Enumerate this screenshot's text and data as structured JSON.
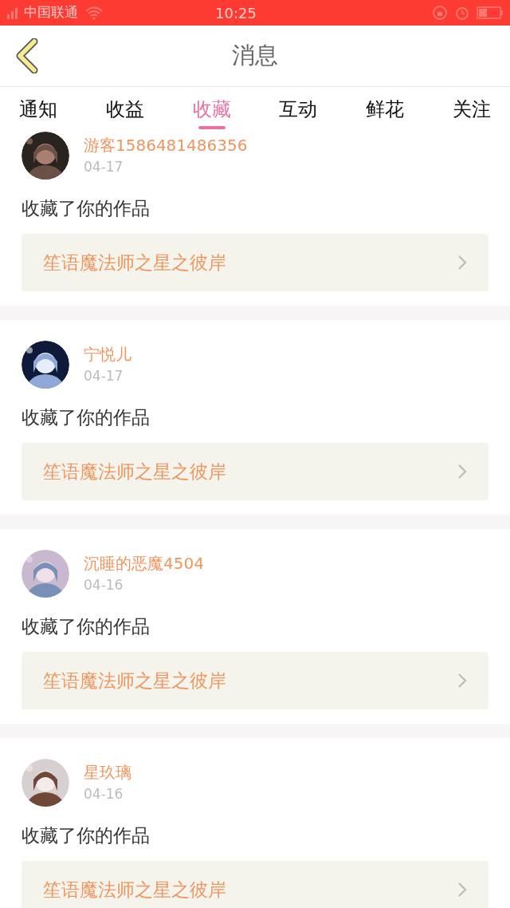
{
  "status_bar": {
    "carrier": "中国联通",
    "time": "10:25"
  },
  "header": {
    "title": "消息"
  },
  "tabs": [
    {
      "label": "通知",
      "selected": false
    },
    {
      "label": "收益",
      "selected": false
    },
    {
      "label": "收藏",
      "selected": true
    },
    {
      "label": "互动",
      "selected": false
    },
    {
      "label": "鲜花",
      "selected": false
    },
    {
      "label": "关注",
      "selected": false
    }
  ],
  "messages": [
    {
      "name": "游客1586481486356",
      "date": "04-17",
      "text": "收藏了你的作品",
      "work": "笙语魔法师之星之彼岸"
    },
    {
      "name": "宁悦儿",
      "date": "04-17",
      "text": "收藏了你的作品",
      "work": "笙语魔法师之星之彼岸"
    },
    {
      "name": "沉睡的恶魔4504",
      "date": "04-16",
      "text": "收藏了你的作品",
      "work": "笙语魔法师之星之彼岸"
    },
    {
      "name": "星玖璃",
      "date": "04-16",
      "text": "收藏了你的作品",
      "work": "笙语魔法师之星之彼岸"
    }
  ]
}
